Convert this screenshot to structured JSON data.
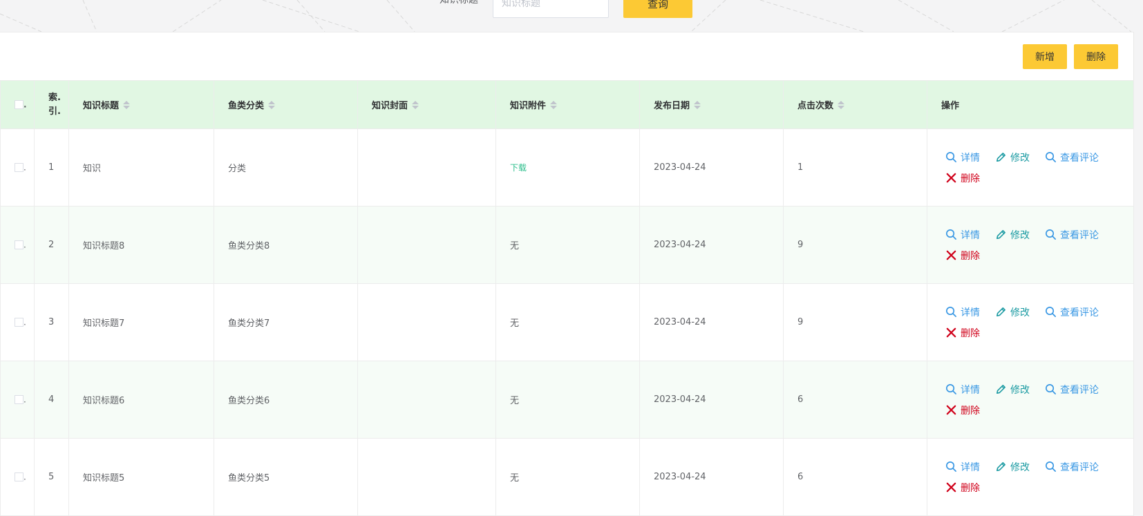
{
  "search": {
    "label": "知识标题",
    "placeholder": "知识标题",
    "button": "查询"
  },
  "toolbar": {
    "add_label": "新增",
    "delete_label": "删除"
  },
  "table": {
    "headers": {
      "index_line1": "索.",
      "index_line2": "引.",
      "title": "知识标题",
      "category": "鱼类分类",
      "cover": "知识封面",
      "attachment": "知识附件",
      "date": "发布日期",
      "clicks": "点击次数",
      "actions": "操作"
    },
    "check_mark": ".",
    "actions": {
      "view": "详情",
      "edit": "修改",
      "comments": "查看评论",
      "delete": "删除"
    },
    "rows": [
      {
        "index": "1",
        "title": "知识",
        "category": "分类",
        "attachment": "下载",
        "date": "2023-04-24",
        "clicks": "1"
      },
      {
        "index": "2",
        "title": "知识标题8",
        "category": "鱼类分类8",
        "attachment": "无",
        "date": "2023-04-24",
        "clicks": "9"
      },
      {
        "index": "3",
        "title": "知识标题7",
        "category": "鱼类分类7",
        "attachment": "无",
        "date": "2023-04-24",
        "clicks": "9"
      },
      {
        "index": "4",
        "title": "知识标题6",
        "category": "鱼类分类6",
        "attachment": "无",
        "date": "2023-04-24",
        "clicks": "6"
      },
      {
        "index": "5",
        "title": "知识标题5",
        "category": "鱼类分类5",
        "attachment": "无",
        "date": "2023-04-24",
        "clicks": "6"
      }
    ]
  },
  "colors": {
    "accent": "#fcc934",
    "header_bg": "#e1f7e3",
    "link_blue": "#3a98e4",
    "edit_teal": "#1a9aa2",
    "delete_red": "#d0021b",
    "download_green": "#2dbe8c"
  }
}
